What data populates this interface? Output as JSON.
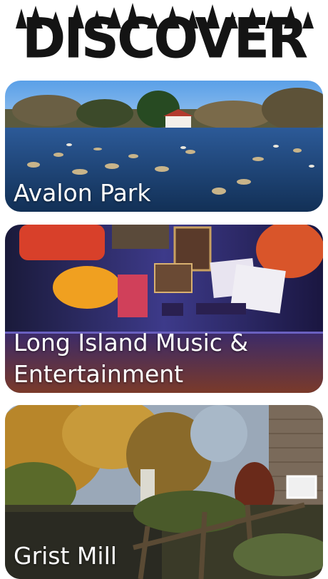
{
  "header": {
    "title": "DISCOVER",
    "decoration_icon": "pine-tree-silhouette-icon"
  },
  "places": [
    {
      "label": "Avalon Park",
      "image_icon": "pond-with-geese-image"
    },
    {
      "label_line1": "Long Island Music &",
      "label_line2": "Entertainment",
      "image_icon": "music-memorabilia-display-image"
    },
    {
      "label": "Grist Mill",
      "image_icon": "autumn-grist-mill-image"
    }
  ],
  "colors": {
    "background": "#ffffff",
    "logo": "#141414",
    "label_text": "#ffffff"
  }
}
